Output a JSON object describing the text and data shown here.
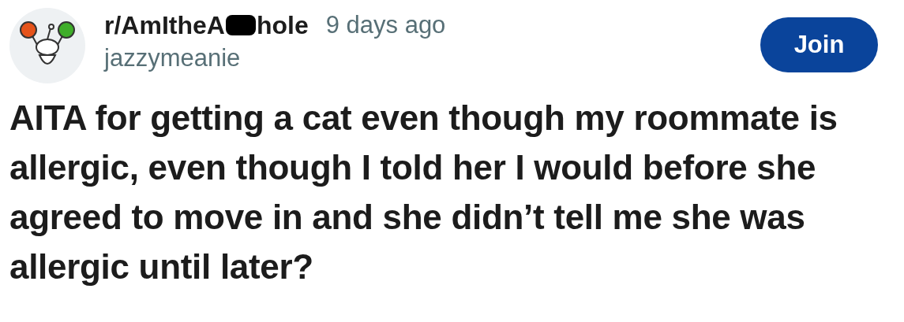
{
  "post": {
    "subreddit_before_redaction": "r/AmItheA",
    "subreddit_after_redaction": "hole",
    "time": "9 days ago",
    "author": "jazzymeanie",
    "join_button": "Join",
    "title": "AITA for getting a cat even though my roommate is allergic, even though I told her I would before she agreed to move in and she didn’t tell me she was allergic until later?"
  }
}
